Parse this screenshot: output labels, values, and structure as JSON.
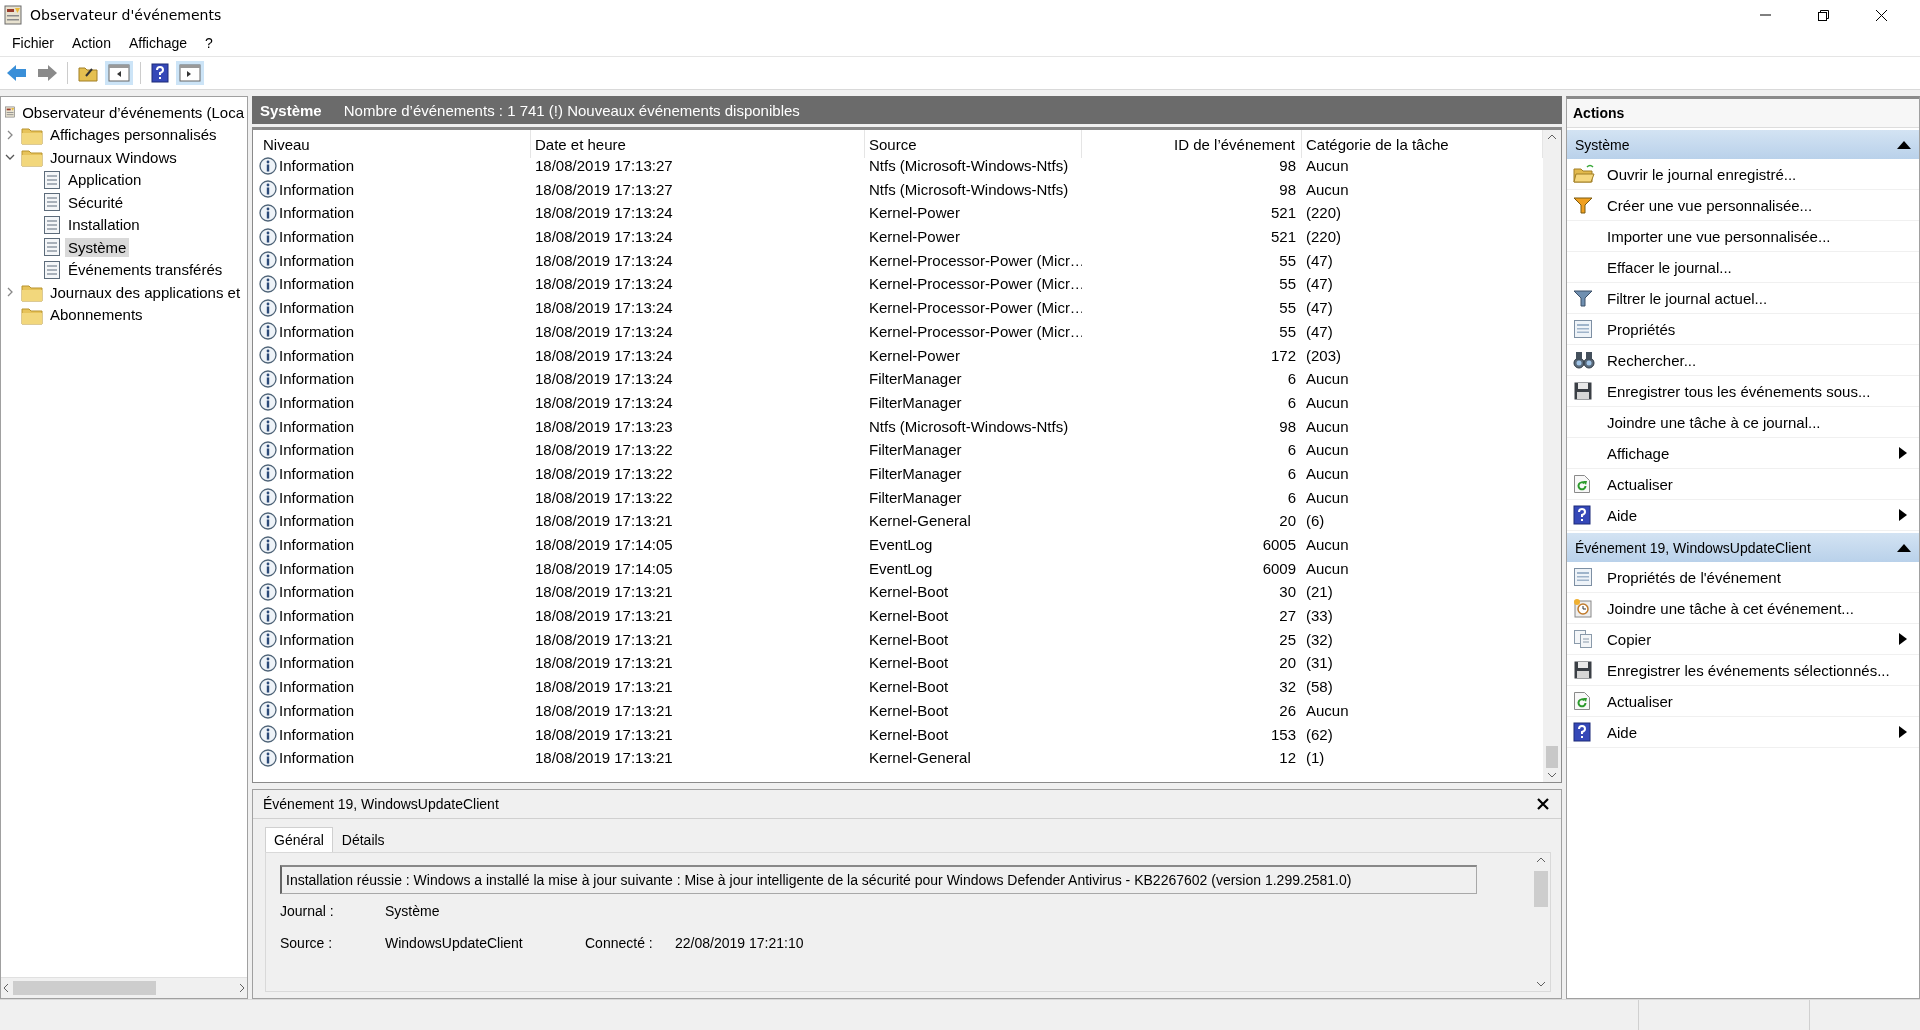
{
  "window": {
    "title": "Observateur d'événements"
  },
  "menu": [
    "Fichier",
    "Action",
    "Affichage",
    "?"
  ],
  "tree": [
    {
      "label": "Observateur d’événements (Loca",
      "selected": false,
      "children": [
        {
          "label": "Affichages personnalisés",
          "selected": false,
          "expanded": false
        },
        {
          "label": "Journaux Windows",
          "selected": false,
          "expanded": true,
          "children": [
            {
              "label": "Application",
              "selected": false
            },
            {
              "label": "Sécurité",
              "selected": false
            },
            {
              "label": "Installation",
              "selected": false
            },
            {
              "label": "Système",
              "selected": true
            },
            {
              "label": "Événements transférés",
              "selected": false
            }
          ]
        },
        {
          "label": "Journaux des applications et",
          "selected": false,
          "expanded": false
        },
        {
          "label": "Abonnements",
          "selected": false
        }
      ]
    }
  ],
  "events": {
    "log_name": "Système",
    "summary": "Nombre d’événements : 1 741 (!) Nouveaux événements disponibles",
    "columns": [
      "Niveau",
      "Date et heure",
      "Source",
      "ID de l’événement",
      "Catégorie de la tâche"
    ],
    "rows": [
      [
        "Information",
        "18/08/2019 17:13:27",
        "Ntfs (Microsoft-Windows-Ntfs)",
        "98",
        "Aucun"
      ],
      [
        "Information",
        "18/08/2019 17:13:27",
        "Ntfs (Microsoft-Windows-Ntfs)",
        "98",
        "Aucun"
      ],
      [
        "Information",
        "18/08/2019 17:13:24",
        "Kernel-Power",
        "521",
        "(220)"
      ],
      [
        "Information",
        "18/08/2019 17:13:24",
        "Kernel-Power",
        "521",
        "(220)"
      ],
      [
        "Information",
        "18/08/2019 17:13:24",
        "Kernel-Processor-Power (Micr…",
        "55",
        "(47)"
      ],
      [
        "Information",
        "18/08/2019 17:13:24",
        "Kernel-Processor-Power (Micr…",
        "55",
        "(47)"
      ],
      [
        "Information",
        "18/08/2019 17:13:24",
        "Kernel-Processor-Power (Micr…",
        "55",
        "(47)"
      ],
      [
        "Information",
        "18/08/2019 17:13:24",
        "Kernel-Processor-Power (Micr…",
        "55",
        "(47)"
      ],
      [
        "Information",
        "18/08/2019 17:13:24",
        "Kernel-Power",
        "172",
        "(203)"
      ],
      [
        "Information",
        "18/08/2019 17:13:24",
        "FilterManager",
        "6",
        "Aucun"
      ],
      [
        "Information",
        "18/08/2019 17:13:24",
        "FilterManager",
        "6",
        "Aucun"
      ],
      [
        "Information",
        "18/08/2019 17:13:23",
        "Ntfs (Microsoft-Windows-Ntfs)",
        "98",
        "Aucun"
      ],
      [
        "Information",
        "18/08/2019 17:13:22",
        "FilterManager",
        "6",
        "Aucun"
      ],
      [
        "Information",
        "18/08/2019 17:13:22",
        "FilterManager",
        "6",
        "Aucun"
      ],
      [
        "Information",
        "18/08/2019 17:13:22",
        "FilterManager",
        "6",
        "Aucun"
      ],
      [
        "Information",
        "18/08/2019 17:13:21",
        "Kernel-General",
        "20",
        "(6)"
      ],
      [
        "Information",
        "18/08/2019 17:14:05",
        "EventLog",
        "6005",
        "Aucun"
      ],
      [
        "Information",
        "18/08/2019 17:14:05",
        "EventLog",
        "6009",
        "Aucun"
      ],
      [
        "Information",
        "18/08/2019 17:13:21",
        "Kernel-Boot",
        "30",
        "(21)"
      ],
      [
        "Information",
        "18/08/2019 17:13:21",
        "Kernel-Boot",
        "27",
        "(33)"
      ],
      [
        "Information",
        "18/08/2019 17:13:21",
        "Kernel-Boot",
        "25",
        "(32)"
      ],
      [
        "Information",
        "18/08/2019 17:13:21",
        "Kernel-Boot",
        "20",
        "(31)"
      ],
      [
        "Information",
        "18/08/2019 17:13:21",
        "Kernel-Boot",
        "32",
        "(58)"
      ],
      [
        "Information",
        "18/08/2019 17:13:21",
        "Kernel-Boot",
        "26",
        "Aucun"
      ],
      [
        "Information",
        "18/08/2019 17:13:21",
        "Kernel-Boot",
        "153",
        "(62)"
      ],
      [
        "Information",
        "18/08/2019 17:13:21",
        "Kernel-General",
        "12",
        "(1)"
      ]
    ]
  },
  "detail": {
    "title": "Événement 19, WindowsUpdateClient",
    "tabs": [
      {
        "label": "Général",
        "selected": true
      },
      {
        "label": "Détails",
        "selected": false
      }
    ],
    "message": "Installation réussie : Windows a installé la mise à jour suivante : Mise à jour intelligente de la sécurité pour Windows Defender Antivirus - KB2267602 (version 1.299.2581.0)",
    "fields": [
      [
        {
          "label": "Journal :",
          "value": "Système"
        }
      ],
      [
        {
          "label": "Source :",
          "value": "WindowsUpdateClient"
        },
        {
          "label": "Connecté :",
          "value": "22/08/2019 17:21:10"
        }
      ]
    ]
  },
  "actions": {
    "title": "Actions",
    "sections": [
      {
        "title": "Système",
        "expanded": true,
        "items": [
          {
            "label": "Ouvrir le journal enregistré...",
            "submenu": false
          },
          {
            "label": "Créer une vue personnalisée...",
            "submenu": false
          },
          {
            "label": "Importer une vue personnalisée...",
            "submenu": false
          },
          {
            "label": "Effacer le journal...",
            "submenu": false
          },
          {
            "label": "Filtrer le journal actuel...",
            "submenu": false
          },
          {
            "label": "Propriétés",
            "submenu": false
          },
          {
            "label": "Rechercher...",
            "submenu": false
          },
          {
            "label": "Enregistrer tous les événements sous...",
            "submenu": false
          },
          {
            "label": "Joindre une tâche à ce journal...",
            "submenu": false
          },
          {
            "label": "Affichage",
            "submenu": true
          },
          {
            "label": "Actualiser",
            "submenu": false
          },
          {
            "label": "Aide",
            "submenu": true
          }
        ]
      },
      {
        "title": "Événement 19, WindowsUpdateClient",
        "expanded": true,
        "items": [
          {
            "label": "Propriétés de l'événement",
            "submenu": false
          },
          {
            "label": "Joindre une tâche à cet événement...",
            "submenu": false
          },
          {
            "label": "Copier",
            "submenu": true
          },
          {
            "label": "Enregistrer les événements sélectionnés...",
            "submenu": false
          },
          {
            "label": "Actualiser",
            "submenu": false
          },
          {
            "label": "Aide",
            "submenu": true
          }
        ]
      }
    ]
  }
}
